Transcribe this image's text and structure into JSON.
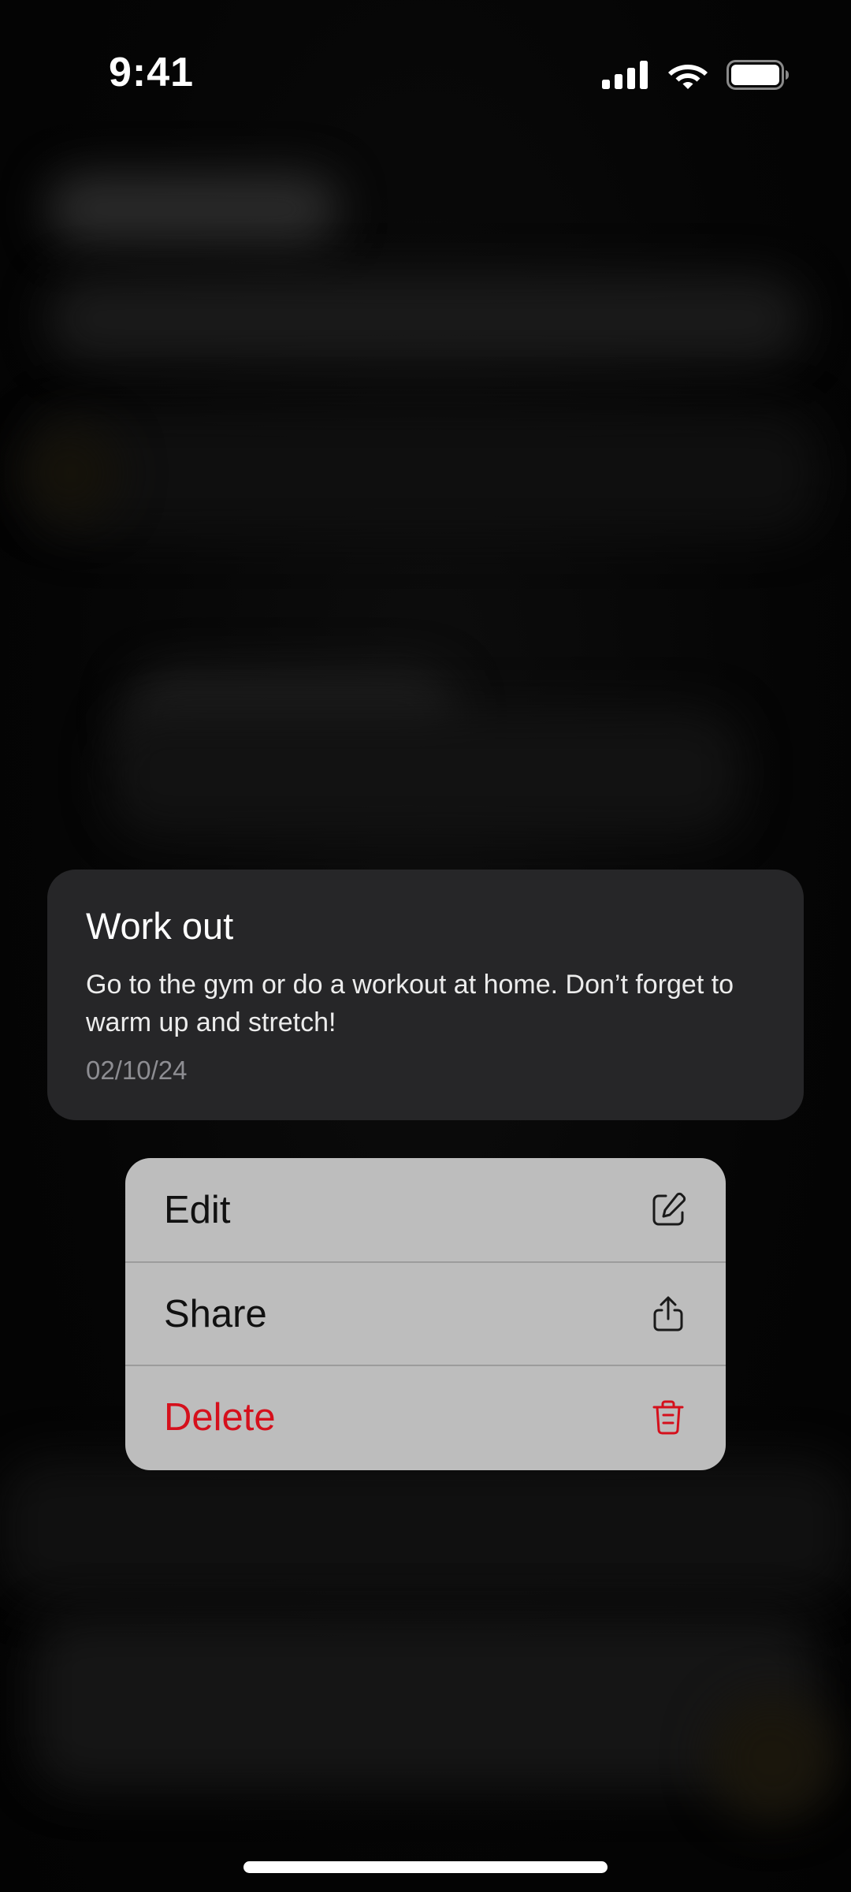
{
  "status_bar": {
    "time": "9:41",
    "icons": [
      "cellular-signal-icon",
      "wifi-icon",
      "battery-icon"
    ]
  },
  "note": {
    "title": "Work out",
    "body": "Go to the gym or do a workout at home. Don’t forget to warm up and stretch!",
    "date": "02/10/24"
  },
  "context_menu": {
    "items": [
      {
        "label": "Edit",
        "icon": "edit-icon"
      },
      {
        "label": "Share",
        "icon": "share-icon"
      },
      {
        "label": "Delete",
        "icon": "trash-icon",
        "destructive": true
      }
    ]
  },
  "colors": {
    "background": "#050505",
    "card": "#262628",
    "menu": "#bdbdbd",
    "destructive": "#d5101c",
    "date_text": "#8d8d92"
  }
}
